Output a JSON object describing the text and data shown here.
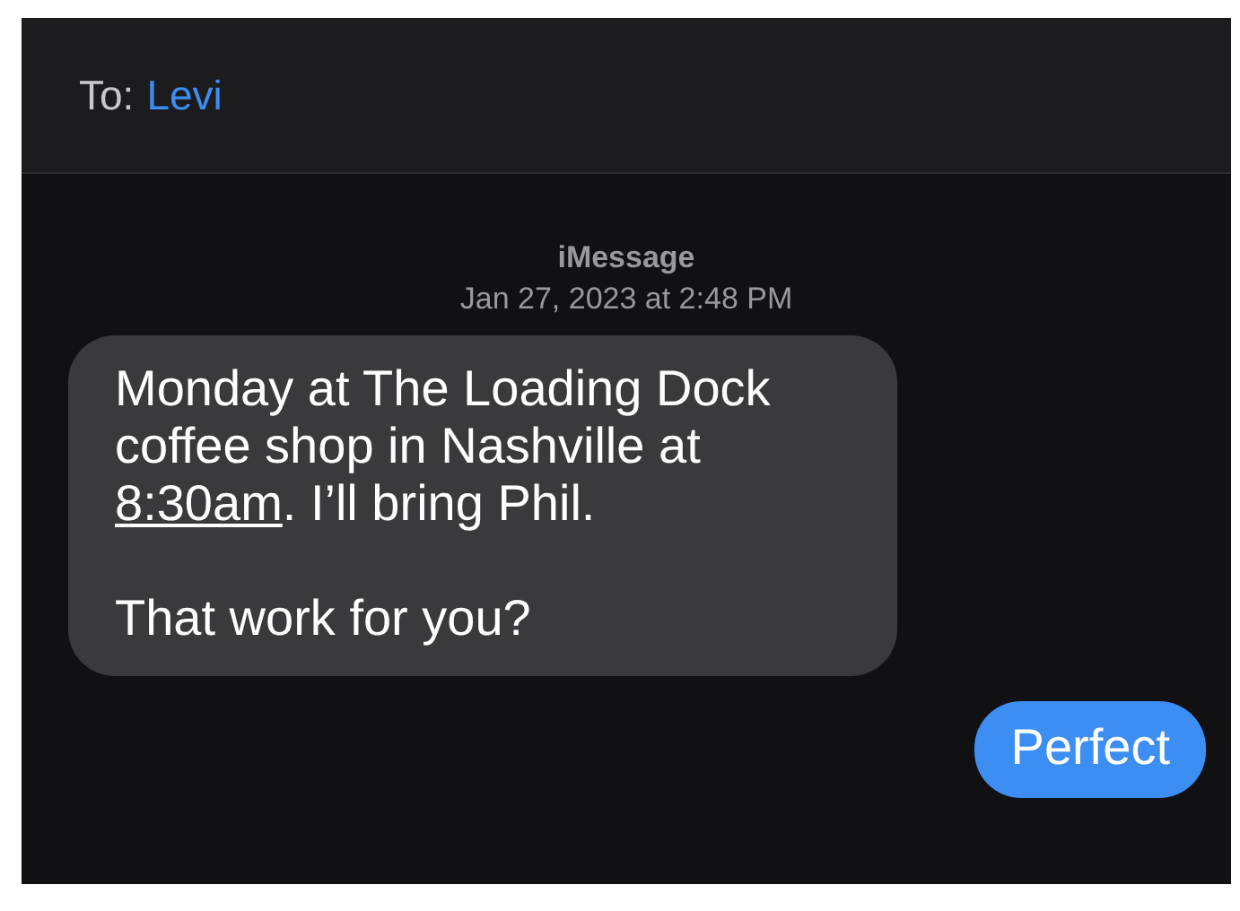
{
  "header": {
    "to_label": "To:",
    "recipient": "Levi"
  },
  "thread": {
    "service": "iMessage",
    "timestamp": "Jan 27, 2023 at 2:48 PM"
  },
  "messages": [
    {
      "kind": "incoming",
      "paragraphs": [
        [
          {
            "text": "Monday at The Loading Dock coffee shop in Nashville at "
          },
          {
            "text": "8:30am",
            "kind": "link"
          },
          {
            "text": ". I’ll bring Phil."
          }
        ],
        [
          {
            "text": "That work for you?"
          }
        ]
      ]
    },
    {
      "kind": "outgoing",
      "paragraphs": [
        [
          {
            "text": "Perfect"
          }
        ]
      ]
    }
  ]
}
